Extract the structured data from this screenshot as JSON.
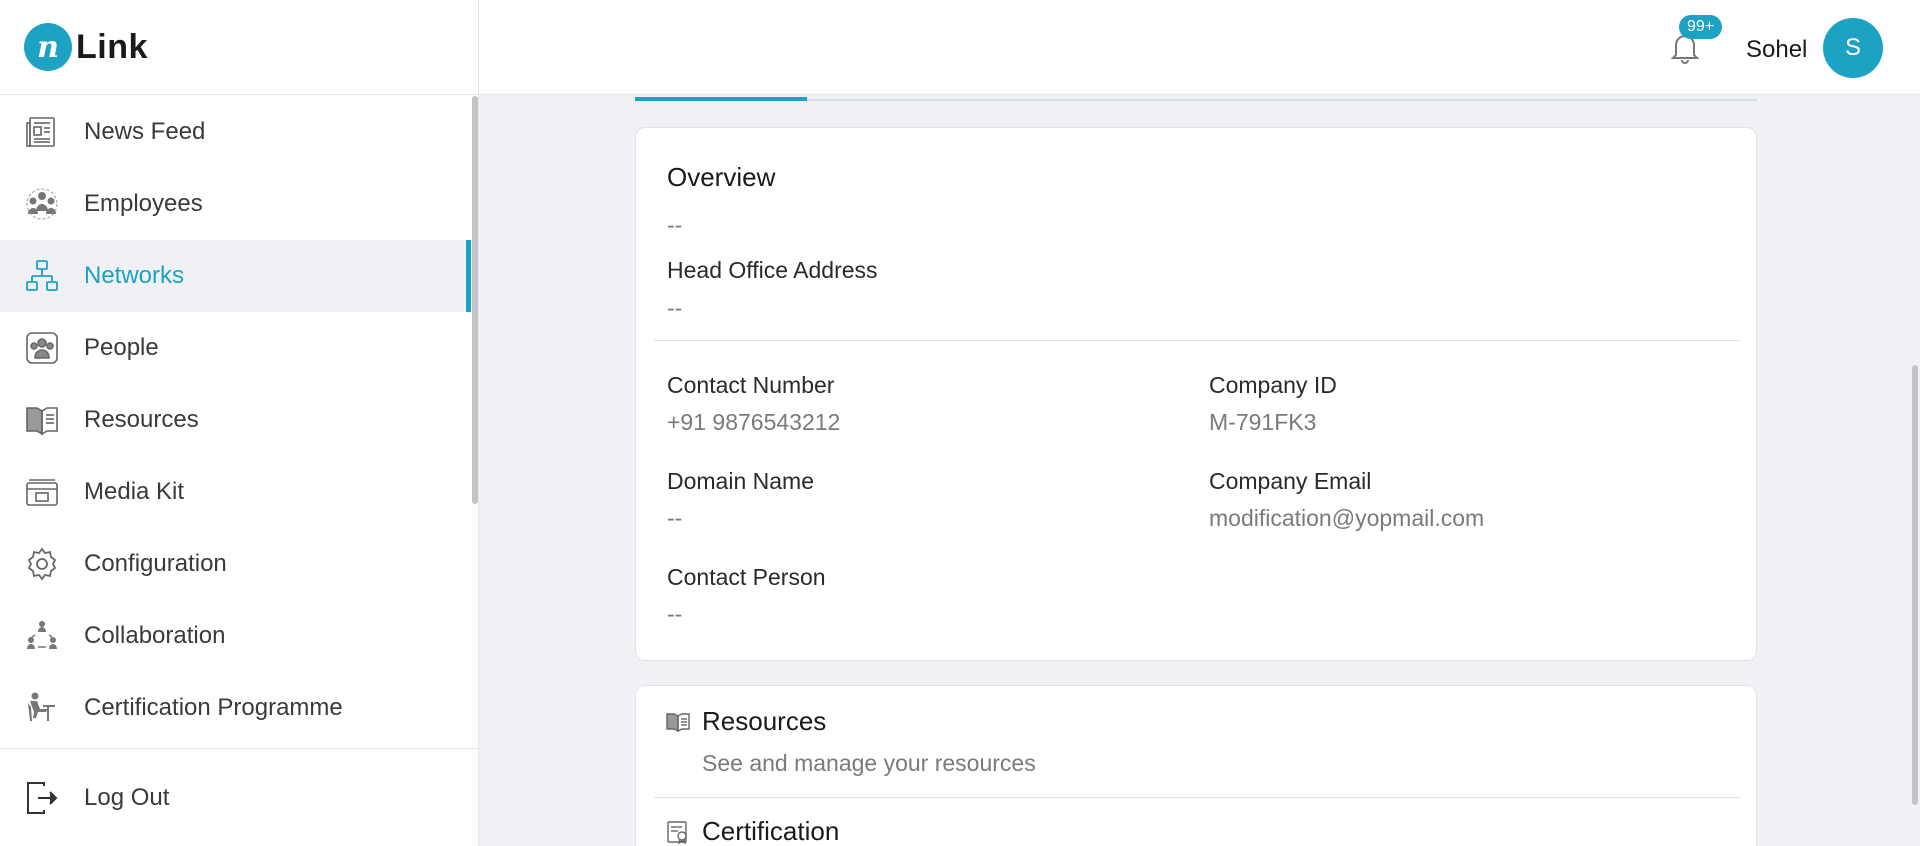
{
  "brand": {
    "mark": "n",
    "name": "Link"
  },
  "sidebar": {
    "items": [
      {
        "label": "News Feed",
        "icon": "newspaper-icon"
      },
      {
        "label": "Employees",
        "icon": "employees-icon"
      },
      {
        "label": "Networks",
        "icon": "network-icon",
        "active": true
      },
      {
        "label": "People",
        "icon": "people-icon"
      },
      {
        "label": "Resources",
        "icon": "book-icon"
      },
      {
        "label": "Media Kit",
        "icon": "media-kit-icon"
      },
      {
        "label": "Configuration",
        "icon": "gear-icon"
      },
      {
        "label": "Collaboration",
        "icon": "collaboration-icon"
      },
      {
        "label": "Certification Programme",
        "icon": "certification-icon"
      }
    ],
    "logout": "Log Out"
  },
  "header": {
    "notifications_badge": "99+",
    "user_name": "Sohel",
    "avatar_initial": "S"
  },
  "overview": {
    "title": "Overview",
    "overview_value": "--",
    "head_office_label": "Head Office Address",
    "head_office_value": "--",
    "contact_number_label": "Contact Number",
    "contact_number_value": "+91 9876543212",
    "company_id_label": "Company ID",
    "company_id_value": "M-791FK3",
    "domain_name_label": "Domain Name",
    "domain_name_value": "--",
    "company_email_label": "Company Email",
    "company_email_value": "modification@yopmail.com",
    "contact_person_label": "Contact Person",
    "contact_person_value": "--"
  },
  "links": {
    "resources_title": "Resources",
    "resources_sub": "See and manage your resources",
    "certification_title": "Certification"
  },
  "colors": {
    "accent": "#1ea2c4",
    "background": "#f0f1f5"
  }
}
